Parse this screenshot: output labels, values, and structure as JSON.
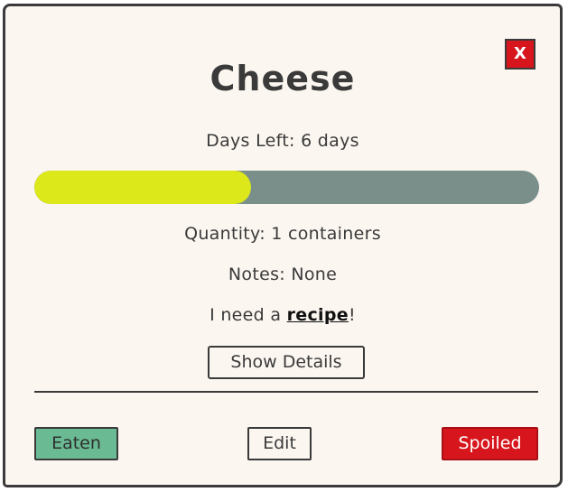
{
  "item": {
    "name": "Cheese",
    "close_label": "X",
    "days_left_text": "Days Left: 6 days",
    "freshness_fraction": 0.43,
    "quantity_text": "Quantity: 1 containers",
    "notes_text": "Notes: None",
    "recipe_prefix": "I need a ",
    "recipe_link": "recipe",
    "recipe_suffix": "!",
    "details_label": "Show Details"
  },
  "actions": {
    "eaten_label": "Eaten",
    "edit_label": "Edit",
    "spoiled_label": "Spoiled"
  },
  "colors": {
    "progress_fill": "#dde81a",
    "progress_track": "#7a8f8a",
    "eaten": "#6abb94",
    "spoiled": "#d7151c",
    "close": "#d7151c",
    "background": "#fbf6f0"
  }
}
